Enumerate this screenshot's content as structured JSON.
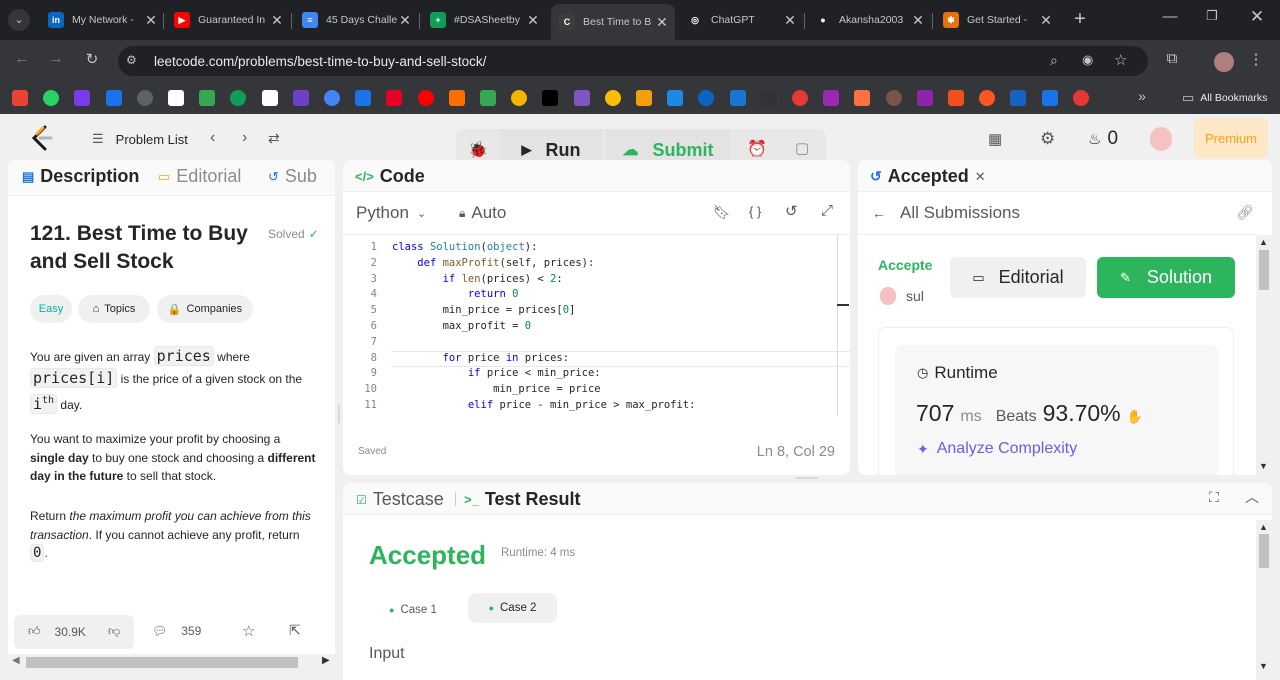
{
  "browser": {
    "tabs": [
      {
        "title": "My Network -",
        "icon": "linkedin-icon",
        "color": "#0a66c2",
        "glyph": "in"
      },
      {
        "title": "Guaranteed In",
        "icon": "youtube-icon",
        "color": "#ff0000",
        "glyph": "▶"
      },
      {
        "title": "45 Days Challe",
        "icon": "docs-icon",
        "color": "#4285f4",
        "glyph": "≡"
      },
      {
        "title": "#DSASheetby",
        "icon": "sheets-icon",
        "color": "#0f9d58",
        "glyph": "+"
      },
      {
        "title": "Best Time to B",
        "icon": "leetcode-icon",
        "color": "#3c3c3c",
        "glyph": "C"
      },
      {
        "title": "ChatGPT",
        "icon": "chatgpt-icon",
        "color": "#ffffff",
        "glyph": "◎"
      },
      {
        "title": "Akansha2003",
        "icon": "github-icon",
        "color": "#ffffff",
        "glyph": "●"
      },
      {
        "title": "Get Started -",
        "icon": "kaggle-icon",
        "color": "#e8710a",
        "glyph": "✱"
      }
    ],
    "url": "leetcode.com/problems/best-time-to-buy-and-sell-stock/",
    "all_bookmarks": "All Bookmarks",
    "bookmark_colors": [
      "#ea4335",
      "#25d366",
      "#7c3aed",
      "#1a73e8",
      "#5f6368",
      "#ffffff",
      "#34a853",
      "#0f9d58",
      "#ffffff",
      "#6e40c9",
      "#4285f4",
      "#1a73e8",
      "#e60023",
      "#ff0000",
      "#ff6f00",
      "#34a853",
      "#f4b400",
      "#000000",
      "#7e57c2",
      "#fbbc04",
      "#f59e0b",
      "#1e88e5",
      "#0a66c2",
      "#1976d2",
      "#333333",
      "#e53935",
      "#9c27b0",
      "#ff7043",
      "#795548",
      "#8e24aa",
      "#f24e1e",
      "#ff5722",
      "#1565c0",
      "#1a73e8",
      "#e53935"
    ]
  },
  "nav": {
    "problem_list": "Problem List",
    "run": "Run",
    "submit": "Submit",
    "streak": "0",
    "premium": "Premium"
  },
  "left": {
    "tabs": {
      "description": "Description",
      "editorial": "Editorial",
      "submissions": "Sub"
    },
    "title_line1": "121. Best Time to Buy",
    "title_line2": "and Sell Stock",
    "solved": "Solved",
    "difficulty": "Easy",
    "topics": "Topics",
    "companies": "Companies",
    "p1_a": "You are given an array ",
    "p1_code1": "prices",
    "p1_b": " where",
    "p1_code2": "prices[i]",
    "p1_c": " is the price of a given stock on the",
    "p1_code3": "i",
    "p1_sup": "th",
    "p1_d": " day.",
    "p2_a": "You want to maximize your profit by choosing a",
    "p2_b": "single day",
    "p2_c": " to buy one stock and choosing a ",
    "p2_d": "different",
    "p2_e": "day in the future",
    "p2_f": " to sell that stock.",
    "p3_a": "Return ",
    "p3_b": "the maximum profit you can achieve from this",
    "p3_c": "transaction",
    "p3_d": ". If you cannot achieve any profit, return",
    "p3_code": "0",
    "p3_e": ".",
    "likes": "30.9K",
    "comments": "359"
  },
  "code": {
    "title": "Code",
    "language": "Python",
    "mode": "Auto",
    "saved": "Saved",
    "cursor": "Ln 8, Col 29",
    "lines": [
      {
        "n": "1",
        "text": "class Solution(object):"
      },
      {
        "n": "2",
        "text": "    def maxProfit(self, prices):"
      },
      {
        "n": "3",
        "text": "        if len(prices) < 2:"
      },
      {
        "n": "4",
        "text": "            return 0"
      },
      {
        "n": "5",
        "text": "        min_price = prices[0]"
      },
      {
        "n": "6",
        "text": "        max_profit = 0"
      },
      {
        "n": "7",
        "text": ""
      },
      {
        "n": "8",
        "text": "        for price in prices:"
      },
      {
        "n": "9",
        "text": "            if price < min_price:"
      },
      {
        "n": "10",
        "text": "                min_price = price"
      },
      {
        "n": "11",
        "text": "            elif price - min_price > max_profit:"
      }
    ]
  },
  "submission": {
    "tab": "Accepted",
    "all_submissions": "All Submissions",
    "status": "Accepte",
    "user": "sul",
    "editorial": "Editorial",
    "solution": "Solution",
    "runtime_label": "Runtime",
    "runtime_value": "707",
    "runtime_unit": "ms",
    "beats_label": "Beats",
    "beats_value": "93.70%",
    "analyze": "Analyze Complexity"
  },
  "result": {
    "testcase_tab": "Testcase",
    "result_tab": "Test Result",
    "status": "Accepted",
    "runtime": "Runtime: 4 ms",
    "case1": "Case 1",
    "case2": "Case 2",
    "input_label": "Input"
  },
  "colors": {
    "accepted": "#2db55d",
    "easy": "#00b8a3",
    "premium": "#ffa116",
    "link": "#6b5ce7"
  }
}
